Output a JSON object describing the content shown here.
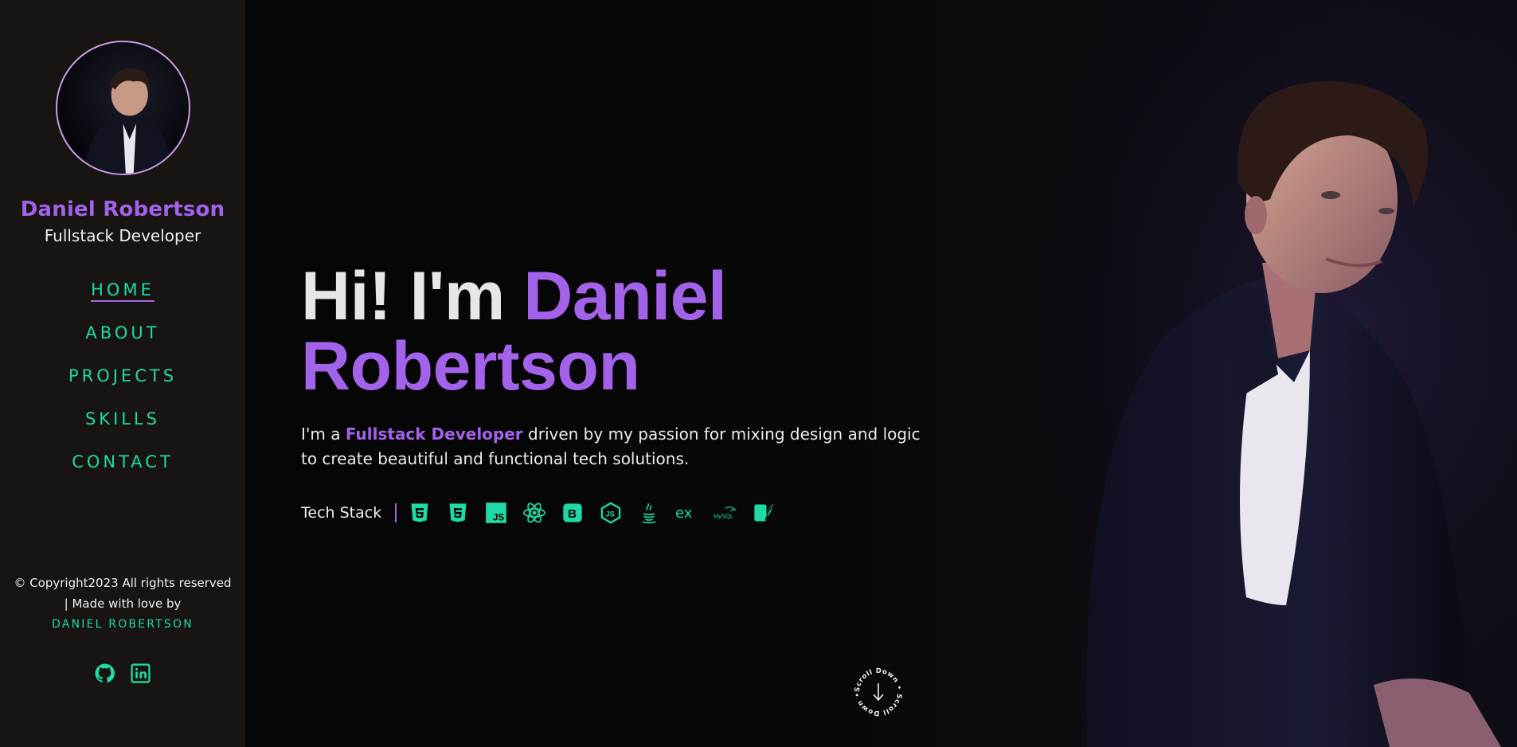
{
  "sidebar": {
    "name": "Daniel Robertson",
    "role": "Fullstack Developer",
    "nav": [
      {
        "label": "HOME",
        "active": true
      },
      {
        "label": "ABOUT",
        "active": false
      },
      {
        "label": "PROJECTS",
        "active": false
      },
      {
        "label": "SKILLS",
        "active": false
      },
      {
        "label": "CONTACT",
        "active": false
      }
    ],
    "copyright_line1": "© Copyright2023 All rights reserved",
    "copyright_line2": "| Made with love by",
    "author": "DANIEL ROBERTSON",
    "socials": [
      "github-icon",
      "linkedin-icon"
    ]
  },
  "hero": {
    "greeting": "Hi! I'm ",
    "first_name": "Daniel",
    "last_name": "Robertson",
    "tagline_prefix": "I'm a ",
    "tagline_highlight": "Fullstack Developer",
    "tagline_suffix": " driven by my passion for mixing design and logic to create beautiful and functional tech solutions.",
    "stack_label": "Tech Stack",
    "stack_icons": [
      "html5-icon",
      "css3-icon",
      "javascript-icon",
      "react-icon",
      "bootstrap-icon",
      "nodejs-icon",
      "java-icon",
      "express-icon",
      "mysql-icon",
      "sqlite-icon"
    ],
    "scroll_text": "Scroll Down • Scroll Down •"
  },
  "colors": {
    "accent_purple": "#a362ea",
    "accent_green": "#1fdaa6",
    "sidebar_bg": "#171412"
  }
}
